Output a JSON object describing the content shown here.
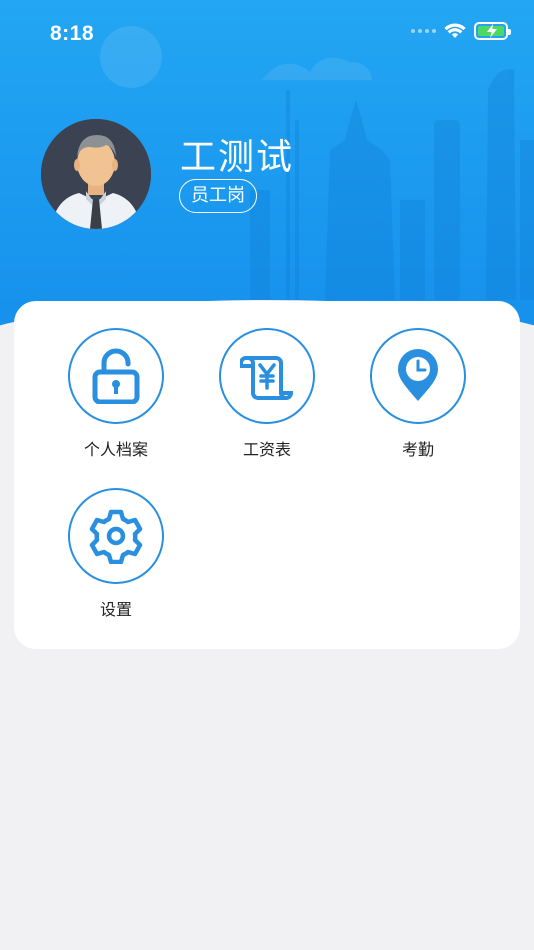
{
  "status_bar": {
    "time": "8:18"
  },
  "profile": {
    "name": "工测试",
    "role": "员工岗"
  },
  "menu": [
    {
      "label": "个人档案",
      "icon": "lock-icon"
    },
    {
      "label": "工资表",
      "icon": "salary-scroll-icon"
    },
    {
      "label": "考勤",
      "icon": "location-clock-icon"
    },
    {
      "label": "设置",
      "icon": "gear-icon"
    }
  ],
  "colors": {
    "header_top": "#23a6f3",
    "header_bottom": "#1590ec",
    "icon_blue": "#2a8fdf",
    "background": "#f1f1f3"
  }
}
